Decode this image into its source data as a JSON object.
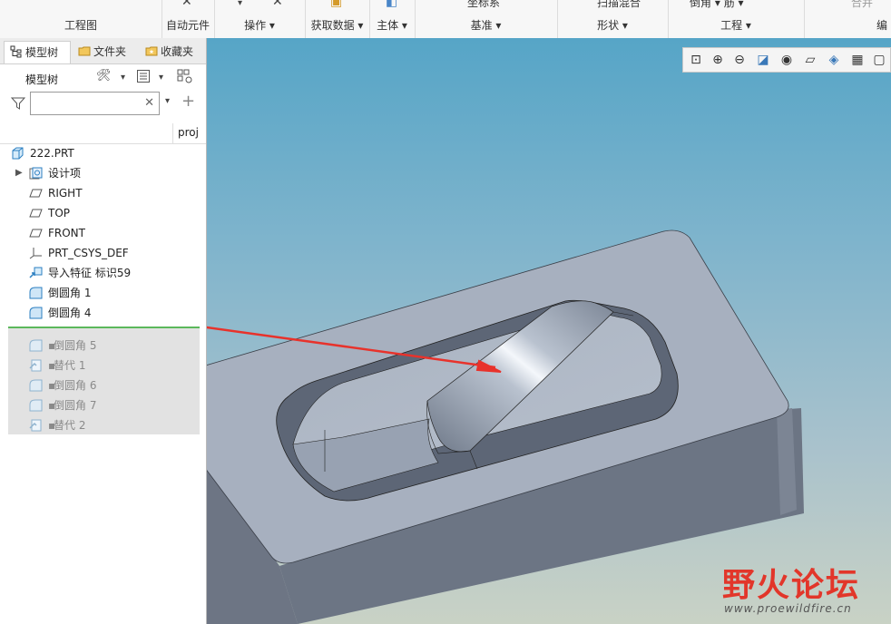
{
  "ribbon": {
    "groups": [
      {
        "label": "工程图"
      },
      {
        "label": "自动元件"
      },
      {
        "label": "操作 ▾"
      },
      {
        "label": "获取数据 ▾"
      },
      {
        "label": "主体 ▾"
      },
      {
        "label": "基准 ▾",
        "top_text": "坐标系"
      },
      {
        "label": "形状 ▾",
        "top_text": "扫描混合"
      },
      {
        "label": "工程 ▾",
        "top_text": "倒角 ▾   筋 ▾"
      },
      {
        "label": "编",
        "top_text": "合并"
      }
    ]
  },
  "panel": {
    "tabs": [
      "模型树",
      "文件夹",
      "收藏夹"
    ],
    "toolbar_title": "模型树",
    "filter_placeholder": "",
    "column_header": "proj",
    "tree": [
      {
        "label": "222.PRT",
        "icon": "part-icon"
      },
      {
        "label": "设计项",
        "icon": "design-items-icon",
        "expandable": true
      },
      {
        "label": "RIGHT",
        "icon": "datum-plane-icon"
      },
      {
        "label": "TOP",
        "icon": "datum-plane-icon"
      },
      {
        "label": "FRONT",
        "icon": "datum-plane-icon"
      },
      {
        "label": "PRT_CSYS_DEF",
        "icon": "csys-icon"
      },
      {
        "label": "导入特征 标识59",
        "icon": "import-feature-icon"
      },
      {
        "label": "倒圆角 1",
        "icon": "round-icon"
      },
      {
        "label": "倒圆角 4",
        "icon": "round-icon"
      },
      {
        "label": "倒圆角 5",
        "icon": "round-icon",
        "suppressed": true
      },
      {
        "label": "替代 1",
        "icon": "substitute-icon",
        "suppressed": true
      },
      {
        "label": "倒圆角 6",
        "icon": "round-icon",
        "suppressed": true
      },
      {
        "label": "倒圆角 7",
        "icon": "round-icon",
        "suppressed": true
      },
      {
        "label": "替代 2",
        "icon": "substitute-icon",
        "suppressed": true
      }
    ]
  },
  "viewport": {
    "toolbar_icons": [
      "zoom-fit-icon",
      "zoom-in-icon",
      "zoom-out-icon",
      "repaint-icon",
      "display-style-icon",
      "view-orient-icon",
      "saved-views-icon",
      "datum-display-icon",
      "more-icon"
    ]
  },
  "watermark": {
    "chinese": "野火论坛",
    "url": "www.proewildfire.cn"
  },
  "colors": {
    "arrow": "#e8322b",
    "insert_line": "#5cb85c",
    "model_top": "#a7b0bf",
    "model_side": "#6c7584"
  }
}
